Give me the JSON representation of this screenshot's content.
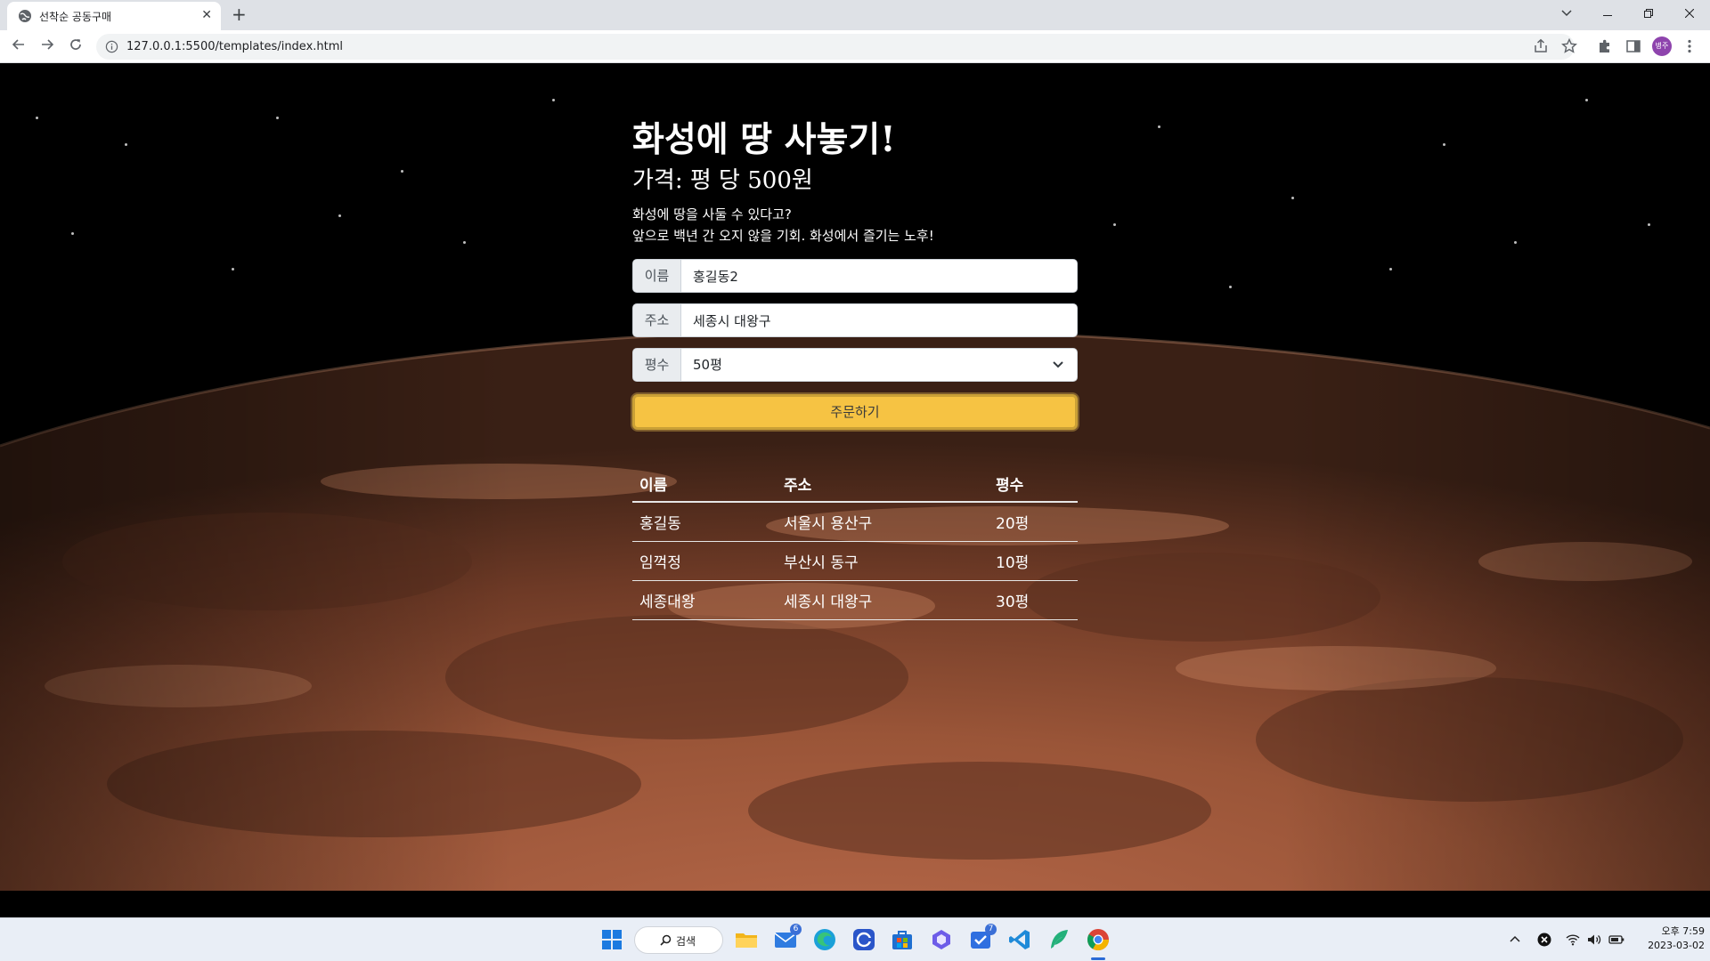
{
  "browser": {
    "tab_title": "선착순 공동구매",
    "tab_close": "✕",
    "new_tab": "+",
    "url": "127.0.0.1:5500/templates/index.html",
    "profile_initials": "병주"
  },
  "page": {
    "title": "화성에 땅 사놓기!",
    "price": "가격: 평 당 500원",
    "desc_line1": "화성에 땅을 사둘 수 있다고?",
    "desc_line2": "앞으로 백년 간 오지 않을 기회. 화성에서 즐기는 노후!"
  },
  "form": {
    "name_label": "이름",
    "name_value": "홍길동2",
    "address_label": "주소",
    "address_value": "세종시 대왕구",
    "size_label": "평수",
    "size_value": "50평",
    "order_button": "주문하기"
  },
  "table": {
    "headers": [
      "이름",
      "주소",
      "평수"
    ],
    "rows": [
      [
        "홍길동",
        "서울시 용산구",
        "20평"
      ],
      [
        "임꺽정",
        "부산시 동구",
        "10평"
      ],
      [
        "세종대왕",
        "세종시 대왕구",
        "30평"
      ]
    ]
  },
  "taskbar": {
    "search_label": "검색",
    "mail_badge": "6",
    "todo_badge": "7",
    "clock_time": "오후 7:59",
    "clock_date": "2023-03-02"
  },
  "colors": {
    "accent_button": "#f6c343",
    "profile": "#8e44ad",
    "taskbar": "#e9eef6"
  }
}
